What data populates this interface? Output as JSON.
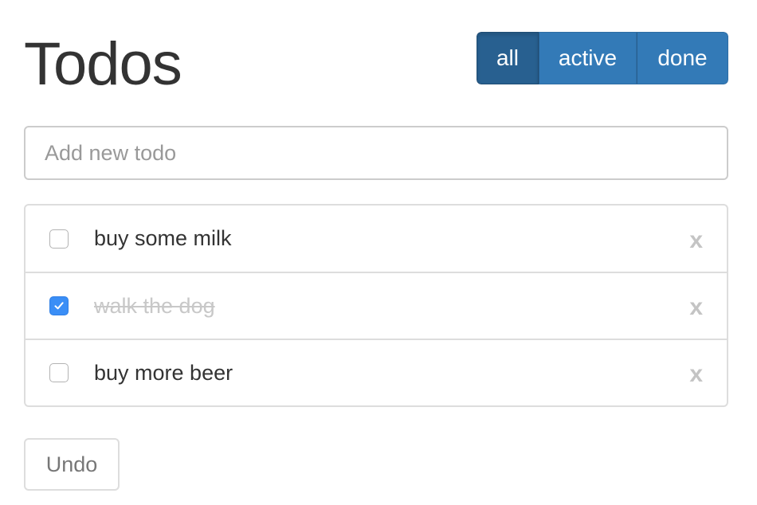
{
  "header": {
    "title": "Todos"
  },
  "filters": [
    {
      "label": "all",
      "selected": true
    },
    {
      "label": "active",
      "selected": false
    },
    {
      "label": "done",
      "selected": false
    }
  ],
  "new_todo": {
    "placeholder": "Add new todo",
    "value": ""
  },
  "todos": [
    {
      "text": "buy some milk",
      "done": false,
      "delete_label": "x"
    },
    {
      "text": "walk the dog",
      "done": true,
      "delete_label": "x"
    },
    {
      "text": "buy more beer",
      "done": false,
      "delete_label": "x"
    }
  ],
  "footer": {
    "undo_label": "Undo"
  },
  "colors": {
    "primary": "#337ab7",
    "primary_active": "#286090",
    "checkbox_checked": "#3a8ef6",
    "done_text": "#c8c8c8",
    "delete_x": "#c4c4c4"
  },
  "icons": {
    "checkmark": "checkmark-icon"
  }
}
